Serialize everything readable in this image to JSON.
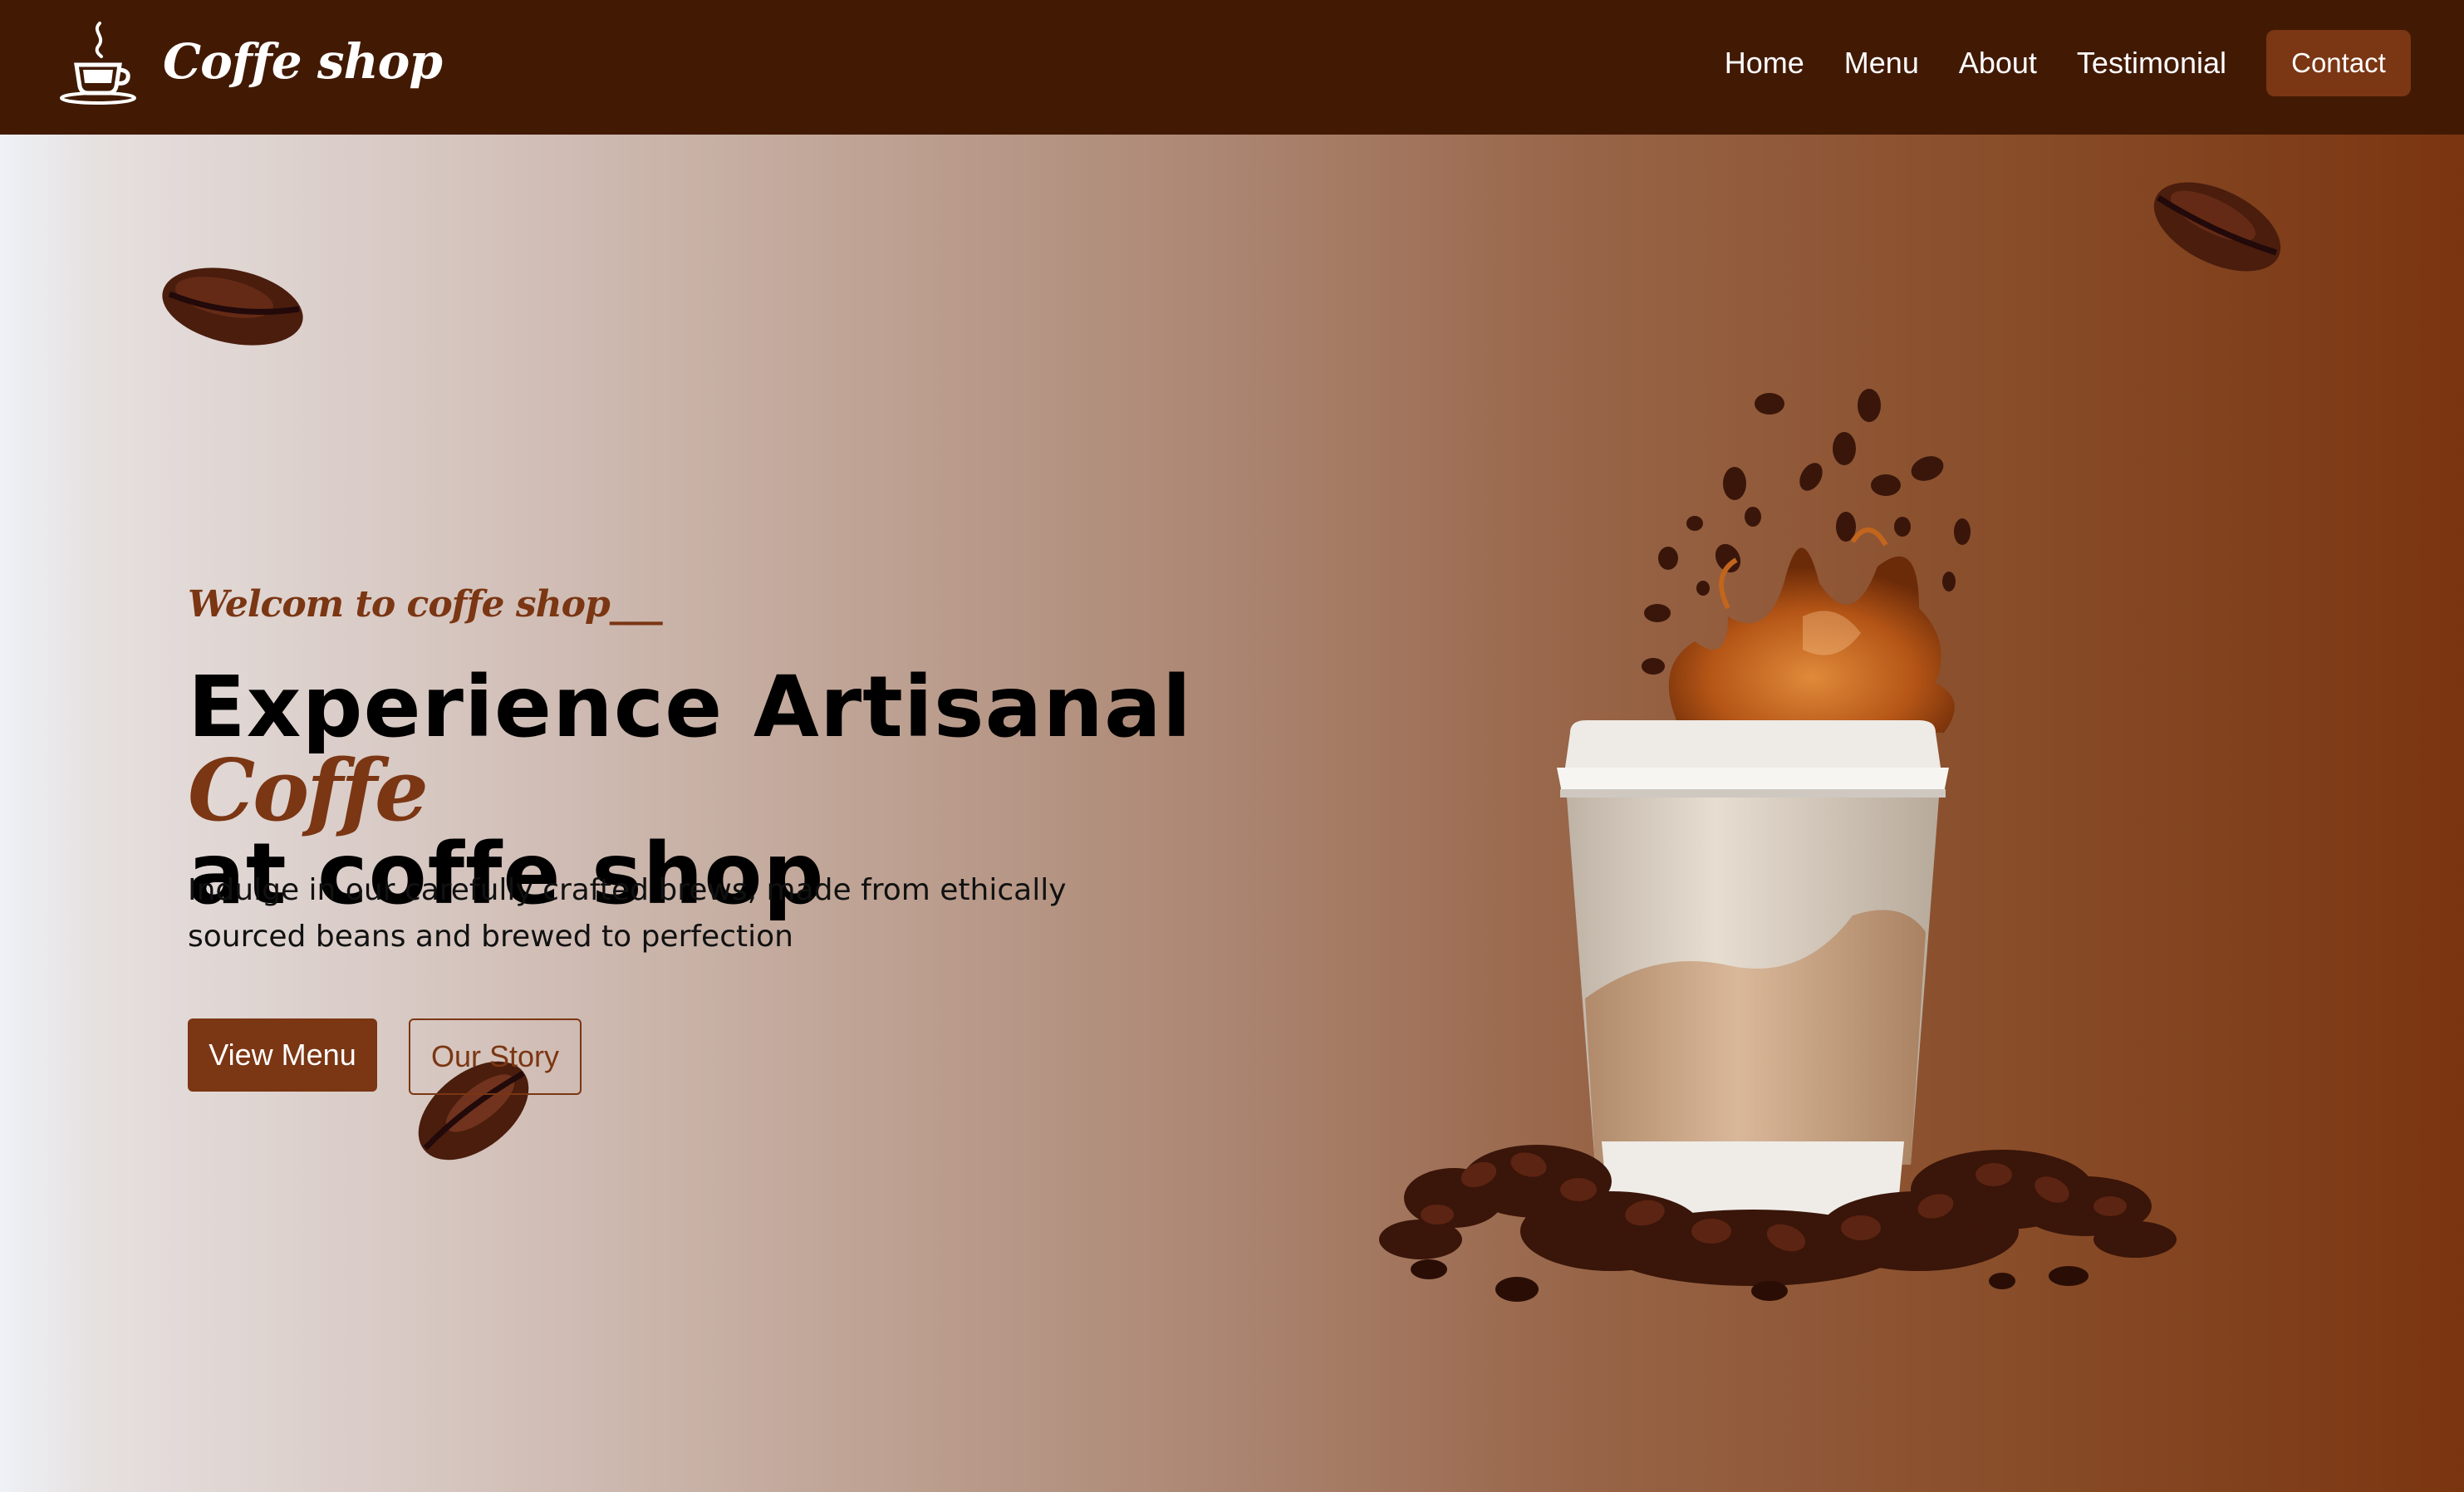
{
  "navbar": {
    "brand_icon": "coffee-cup-icon",
    "brand_name": "Coffe shop",
    "links": [
      {
        "label": "Home"
      },
      {
        "label": "Menu"
      },
      {
        "label": "About"
      },
      {
        "label": "Testimonial"
      }
    ],
    "contact_label": "Contact"
  },
  "hero": {
    "welcome": "Welcom to coffe shop___",
    "headline_start": "Experience Artisanal ",
    "headline_accent": "Coffe",
    "headline_end": "at coffe shop",
    "description": "Indulge in our carefully crafted brews, made from ethically sourced beans and brewed to perfection",
    "primary_button": "View Menu",
    "secondary_button": "Our Story"
  },
  "colors": {
    "navbar_bg": "#421a04",
    "accent": "#7b3613",
    "text_dark": "#000000"
  }
}
